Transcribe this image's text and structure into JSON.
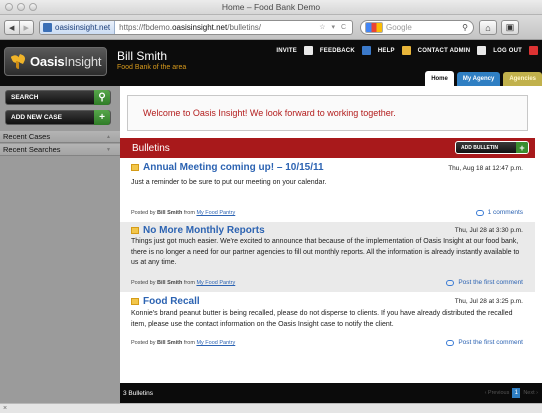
{
  "window": {
    "title": "Home – Food Bank Demo"
  },
  "browser": {
    "site_identity": "oasisinsight.net",
    "url_prefix": "https://fbdemo.",
    "url_domain": "oasisinsight.net",
    "url_path": "/bulletins/",
    "search_placeholder": "Google",
    "back_glyph": "◀",
    "forward_glyph": "▶",
    "url_icons": "☆ ▾ C",
    "home_glyph": "⌂",
    "extra_glyph": "▣"
  },
  "header": {
    "logo_text_bold": "Oasis",
    "logo_text_light": "Insight",
    "user_name": "Bill Smith",
    "org": "Food Bank of the area",
    "links": [
      "INVITE",
      "FEEDBACK",
      "HELP",
      "CONTACT ADMIN",
      "LOG OUT"
    ],
    "tabs": [
      "Home",
      "My Agency",
      "Agencies"
    ]
  },
  "sidebar": {
    "search_label": "SEARCH",
    "add_case_label": "ADD NEW CASE",
    "sections": [
      "Recent Cases",
      "Recent Searches"
    ]
  },
  "main": {
    "welcome": "Welcome to Oasis Insight! We look forward to working together.",
    "bulletins_title": "Bulletins",
    "add_bulletin_label": "ADD BULLETIN",
    "posts": [
      {
        "title": "Annual Meeting coming up! – 10/15/11",
        "date": "Thu, Aug 18 at 12:47 p.m.",
        "body": "Just a reminder to be sure to put our meeting on your calendar.",
        "posted_by_prefix": "Posted by ",
        "author": "Bill Smith",
        "from": " from ",
        "org": "My Food Pantry",
        "comments": "1 comments"
      },
      {
        "title": "No More Monthly Reports",
        "date": "Thu, Jul 28 at 3:30 p.m.",
        "body": "Things just got much easier. We're excited to announce that because of the implementation of Oasis Insight at our food bank, there is no longer a need for our partner agencies to fill out monthly reports. All the information is already instantly available to us at any time.",
        "posted_by_prefix": "Posted by ",
        "author": "Bill Smith",
        "from": " from ",
        "org": "My Food Pantry",
        "comments": "Post the first comment"
      },
      {
        "title": "Food Recall",
        "date": "Thu, Jul 28 at 3:25 p.m.",
        "body": "Konnie's brand peanut butter is being recalled, please do not disperse to clients. If you have already distributed the recalled item, please use the contact information on the Oasis Insight case to notify the client.",
        "posted_by_prefix": "Posted by ",
        "author": "Bill Smith",
        "from": " from ",
        "org": "My Food Pantry",
        "comments": "Post the first comment"
      }
    ],
    "footer_count": "3 Bulletins",
    "pager": {
      "previous": "‹ Previous",
      "current": "1",
      "next": "Next ›"
    }
  },
  "status": {
    "text": "×"
  },
  "colors": {
    "brand_red": "#a8191b",
    "link_blue": "#2c63b2",
    "tab_blue": "#2f7fc3",
    "tab_olive": "#c1b14c",
    "org_orange": "#d89a1c"
  }
}
